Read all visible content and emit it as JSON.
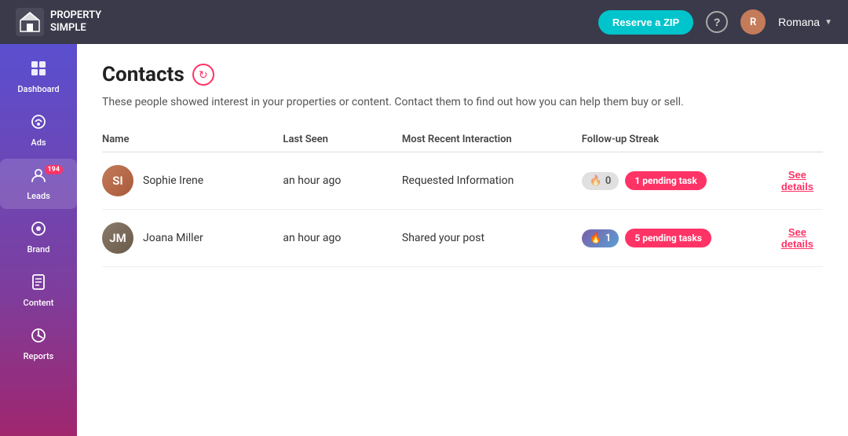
{
  "topnav": {
    "logo_text_line1": "PROPERTY",
    "logo_text_line2": "SIMPLE",
    "reserve_btn": "Reserve a ZIP",
    "user_name": "Romana"
  },
  "sidebar": {
    "items": [
      {
        "id": "dashboard",
        "label": "Dashboard",
        "icon": "⊞",
        "active": false,
        "badge": null
      },
      {
        "id": "ads",
        "label": "Ads",
        "icon": "📢",
        "active": false,
        "badge": null
      },
      {
        "id": "leads",
        "label": "Leads",
        "icon": "👤",
        "active": true,
        "badge": "194"
      },
      {
        "id": "brand",
        "label": "Brand",
        "icon": "◉",
        "active": false,
        "badge": null
      },
      {
        "id": "content",
        "label": "Content",
        "icon": "📄",
        "active": false,
        "badge": null
      },
      {
        "id": "reports",
        "label": "Reports",
        "icon": "📊",
        "active": false,
        "badge": null
      }
    ]
  },
  "main": {
    "title": "Contacts",
    "subtitle": "These people showed interest in your properties or content. Contact them to find out how you can help them buy or sell.",
    "table": {
      "headers": [
        "Name",
        "Last Seen",
        "Most Recent Interaction",
        "Follow-up Streak",
        ""
      ],
      "rows": [
        {
          "id": "sophie",
          "name": "Sophie Irene",
          "last_seen": "an hour ago",
          "interaction": "Requested Information",
          "streak_count": "0",
          "streak_active": false,
          "pending_label": "1 pending task",
          "action_label": "See details"
        },
        {
          "id": "joana",
          "name": "Joana Miller",
          "last_seen": "an hour ago",
          "interaction": "Shared your post",
          "streak_count": "1",
          "streak_active": true,
          "pending_label": "5 pending tasks",
          "action_label": "See details"
        }
      ]
    }
  }
}
